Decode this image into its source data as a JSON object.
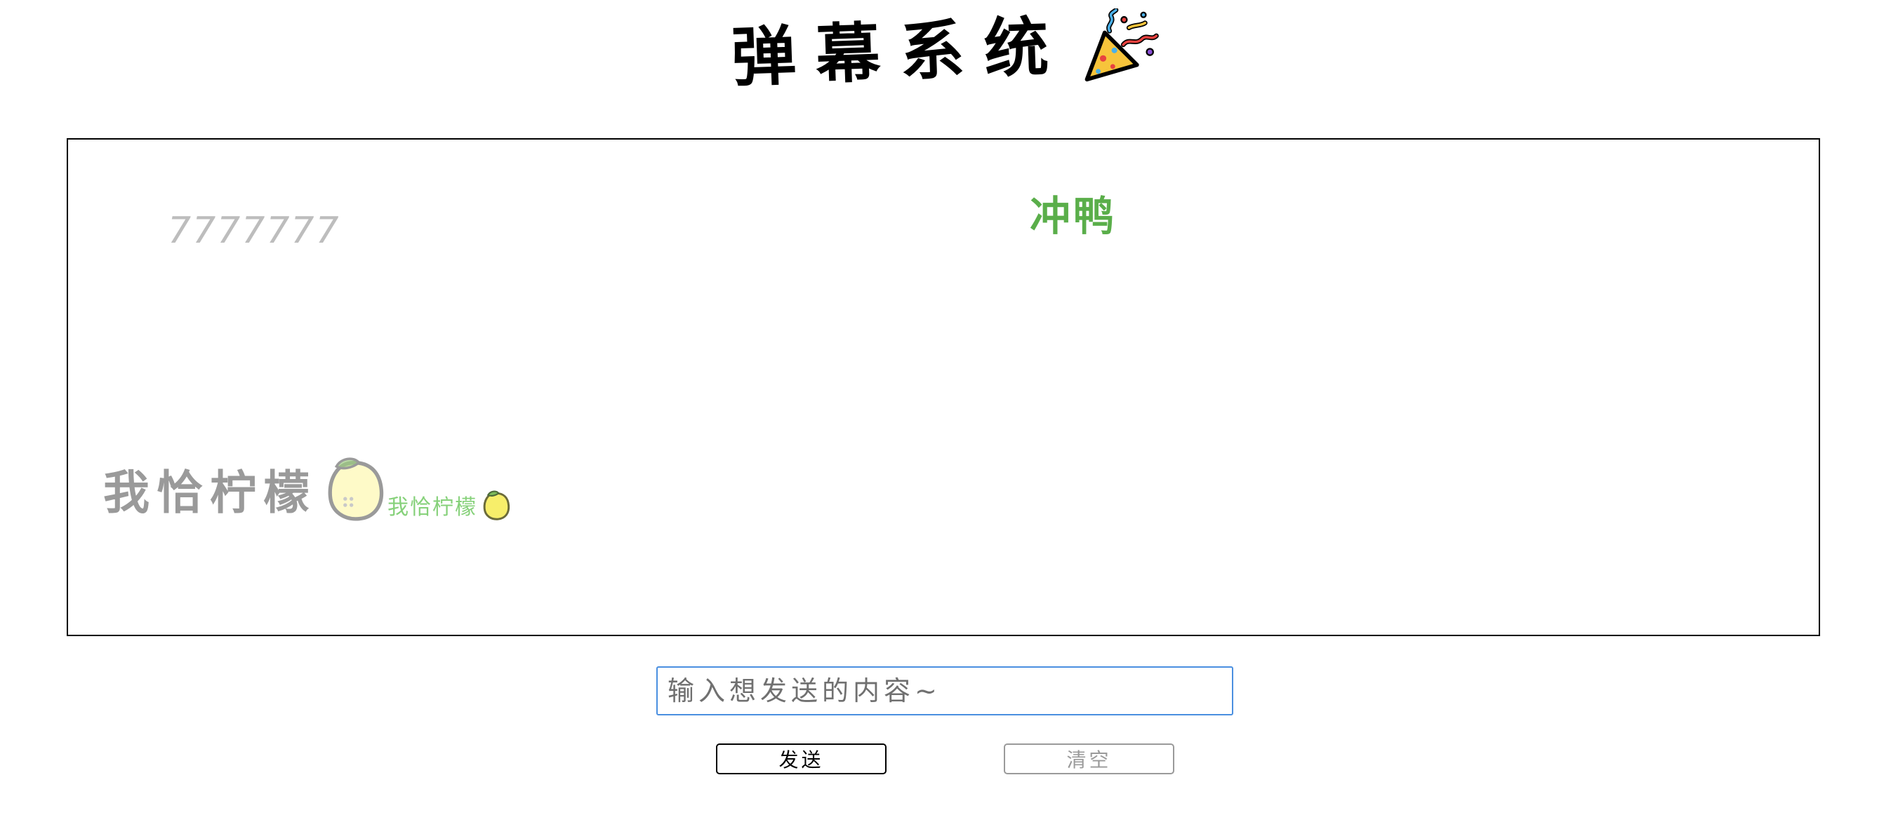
{
  "header": {
    "title": "弹幕系统",
    "icon": "party-popper-icon"
  },
  "stage": {
    "danmu": [
      {
        "text": "7777777",
        "color": "#bdbdbd"
      },
      {
        "text": "冲鸭",
        "color": "#5aae4a"
      },
      {
        "text": "我恰柠檬",
        "color": "#9a9a9a",
        "icon": "lemon-icon"
      },
      {
        "text": "我恰柠檬",
        "color": "#86d17a",
        "icon": "lemon-icon"
      }
    ]
  },
  "composer": {
    "placeholder": "输入想发送的内容~",
    "value": ""
  },
  "actions": {
    "send_label": "发送",
    "clear_label": "清空"
  },
  "colors": {
    "input_border": "#4a8fe0",
    "lemon_fill": "#fdf59a",
    "lemon_leaf": "#9ccc80"
  }
}
